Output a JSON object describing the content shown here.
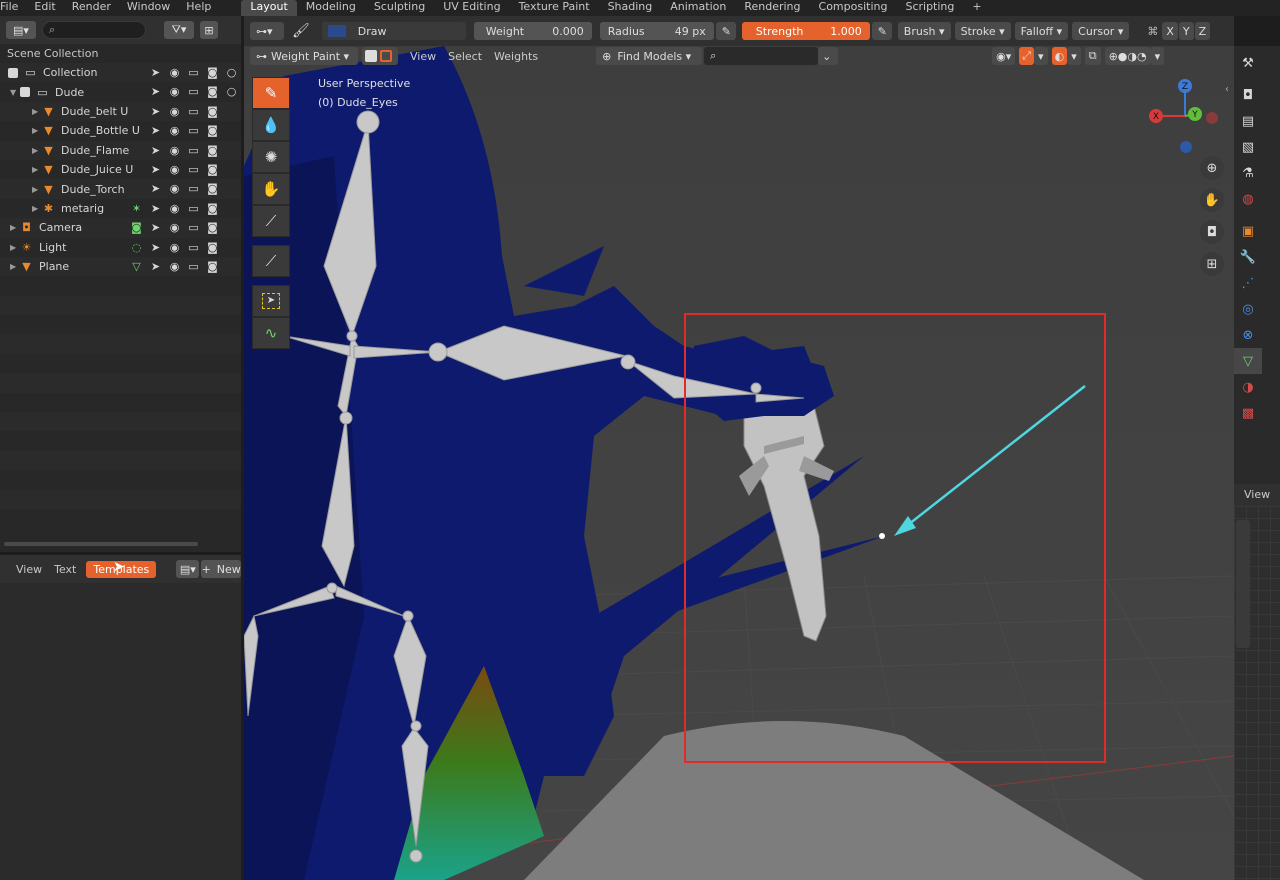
{
  "menubar": {
    "menus": [
      "File",
      "Edit",
      "Render",
      "Window",
      "Help"
    ],
    "workspaces": [
      "Layout",
      "Modeling",
      "Sculpting",
      "UV Editing",
      "Texture Paint",
      "Shading",
      "Animation",
      "Rendering",
      "Compositing",
      "Scripting"
    ],
    "active_workspace": "Layout",
    "add_tab": "+"
  },
  "outliner": {
    "search_icon": "search-icon",
    "scene_collection": "Scene Collection",
    "rows": [
      {
        "name": "Collection",
        "icon": "collection-icon"
      },
      {
        "name": "Dude",
        "icon": "collection-icon"
      },
      {
        "name": "Dude_belt U",
        "icon": "mesh-icon"
      },
      {
        "name": "Dude_Bottle U",
        "icon": "mesh-icon"
      },
      {
        "name": "Dude_Flame",
        "icon": "mesh-icon"
      },
      {
        "name": "Dude_Juice U",
        "icon": "mesh-icon"
      },
      {
        "name": "Dude_Torch",
        "icon": "mesh-icon"
      },
      {
        "name": "metarig",
        "icon": "armature-icon"
      },
      {
        "name": "Camera",
        "icon": "camera-icon"
      },
      {
        "name": "Light",
        "icon": "light-icon"
      },
      {
        "name": "Plane",
        "icon": "mesh-icon"
      }
    ]
  },
  "texteditor": {
    "view": "View",
    "text": "Text",
    "templates": "Templates",
    "new": "New"
  },
  "toolheader": {
    "brush_name": "Draw",
    "weight_label": "Weight",
    "weight_value": "0.000",
    "radius_label": "Radius",
    "radius_value": "49 px",
    "strength_label": "Strength",
    "strength_value": "1.000",
    "brush_menu": "Brush",
    "stroke_menu": "Stroke",
    "falloff_menu": "Falloff",
    "cursor_menu": "Cursor",
    "x": "X",
    "y": "Y",
    "z": "Z"
  },
  "viewport_header": {
    "mode": "Weight Paint",
    "view": "View",
    "select": "Select",
    "weights": "Weights",
    "find_models": "Find Models"
  },
  "viewport": {
    "perspective": "User Perspective",
    "object": "(0) Dude_Eyes"
  },
  "gizmo": {
    "x": "X",
    "y": "Y",
    "z": "Z"
  },
  "properties": {
    "view": "View"
  },
  "colors": {
    "accent": "#e5622d",
    "highlight_box": "#e02b2b",
    "arrow": "#4fd6e0",
    "mesh_blue": "#0d1a6e"
  }
}
